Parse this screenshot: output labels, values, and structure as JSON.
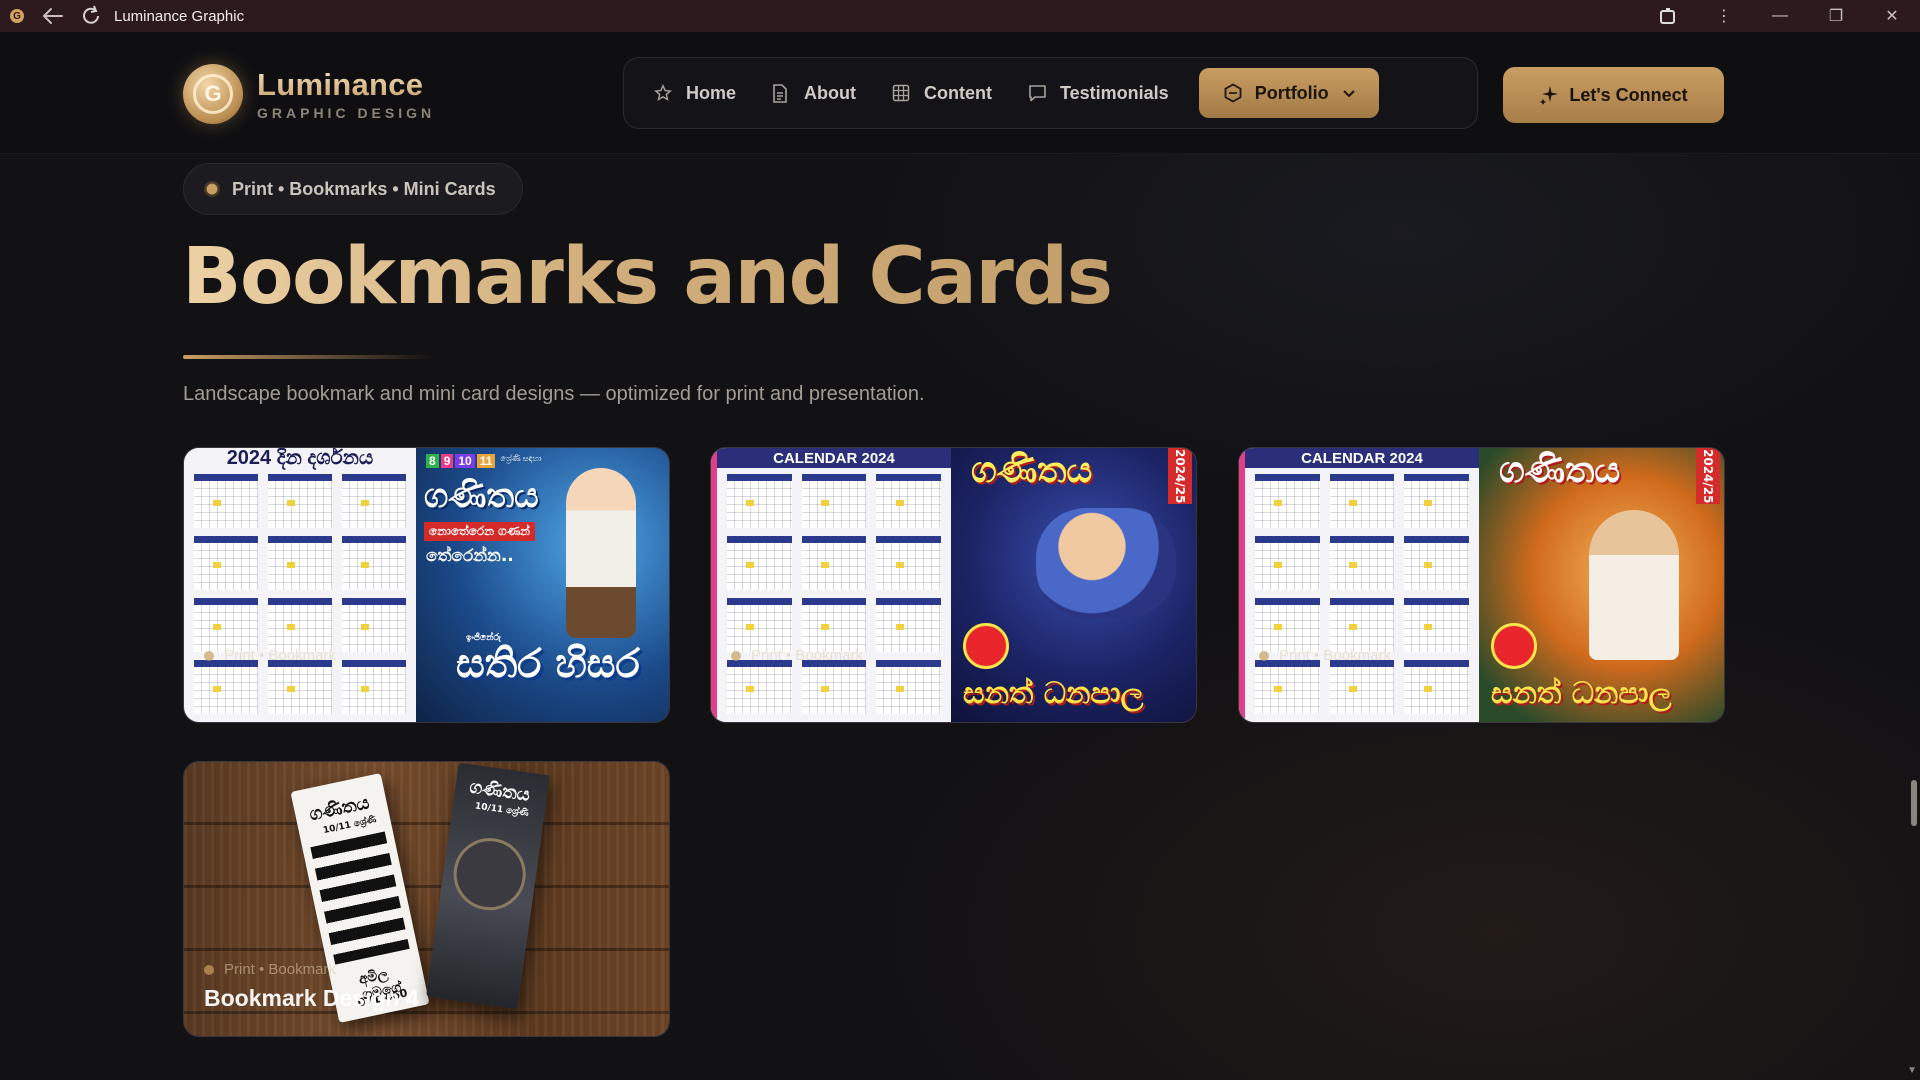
{
  "browser": {
    "title": "Luminance Graphic",
    "back_icon": "arrow-left-icon",
    "reload_icon": "reload-icon"
  },
  "brand": {
    "name": "Luminance",
    "tagline": "GRAPHIC DESIGN",
    "logo_letter": "G"
  },
  "nav": {
    "items": [
      {
        "label": "Home",
        "icon": "star-icon"
      },
      {
        "label": "About",
        "icon": "document-icon"
      },
      {
        "label": "Content",
        "icon": "grid-icon"
      },
      {
        "label": "Testimonials",
        "icon": "chat-icon"
      },
      {
        "label": "Portfolio",
        "icon": "hexagon-icon",
        "active": true
      }
    ],
    "cta": "Let's Connect"
  },
  "section": {
    "tag": "Print • Bookmarks • Mini Cards",
    "title": "Bookmarks and Cards",
    "subtitle": "Landscape bookmark and mini card designs — optimized for print and presentation."
  },
  "cards": [
    {
      "meta": "Print • Bookmark",
      "art": {
        "header": "2024 දින දර්ශනය",
        "grades": [
          "8",
          "9",
          "10",
          "11"
        ],
        "grade_note": "ශ්‍රේණි සඳහා",
        "subject": "ගණිතය",
        "ribbon": "නොතේරෙන ගණන්",
        "line": "තේරෙන්න..",
        "by": "ඉංජිනේරු",
        "teacher": "සතිර හිසර"
      }
    },
    {
      "meta": "Print • Bookmark",
      "art": {
        "header": "CALENDAR 2024",
        "subject": "ගණිතය",
        "year_tag": "2024/25",
        "teacher": "සනත් ධනපාල"
      }
    },
    {
      "meta": "Print • Bookmark",
      "art": {
        "header": "CALENDAR 2024",
        "subject": "ගණිතය",
        "year_tag": "2024/25",
        "teacher": "සනත් ධනපාල"
      }
    },
    {
      "meta": "Print • Bookmark",
      "title": "Bookmark Design 4",
      "art": {
        "left_title": "ගණිතය",
        "left_grade": "10/11 ශ්‍රේණි",
        "right_title": "ගණිතය",
        "right_grade": "10/11 ශ්‍රේණි",
        "name": "අමිල ගමගේ",
        "phone": "071-460"
      }
    }
  ],
  "colors": {
    "accent": "#c99e63",
    "background": "#121114",
    "titlebar": "#2c1a1e"
  }
}
